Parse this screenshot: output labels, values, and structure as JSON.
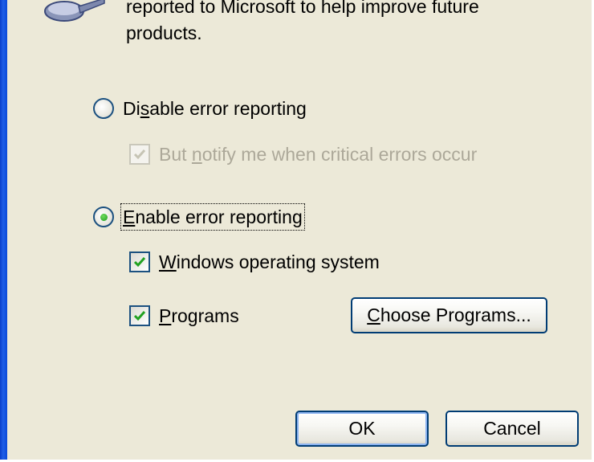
{
  "intro": {
    "line1": "reported to Microsoft to help improve future",
    "line2": "products."
  },
  "options": {
    "disable": {
      "label_pre": "Di",
      "label_u": "s",
      "label_post": "able error reporting",
      "selected": false
    },
    "notify": {
      "label_pre": "But ",
      "label_u": "n",
      "label_post": "otify me when critical errors occur",
      "checked": true,
      "enabled": false
    },
    "enable": {
      "label_pre": "",
      "label_u": "E",
      "label_post": "nable error reporting",
      "selected": true
    },
    "windows": {
      "label_pre": "",
      "label_u": "W",
      "label_post": "indows operating system",
      "checked": true
    },
    "programs": {
      "label_pre": "",
      "label_u": "P",
      "label_post": "rograms",
      "checked": true
    }
  },
  "buttons": {
    "choose_u": "C",
    "choose_rest": "hoose Programs...",
    "ok": "OK",
    "cancel": "Cancel"
  },
  "icons": {
    "top": "error-reporting-icon",
    "check": "checkmark-icon"
  },
  "colors": {
    "dialog_bg": "#ece9d8",
    "accent_border": "#003c74",
    "check_green": "#21a121",
    "disabled_text": "#aca899",
    "title_blue": "#0b4ad8"
  }
}
